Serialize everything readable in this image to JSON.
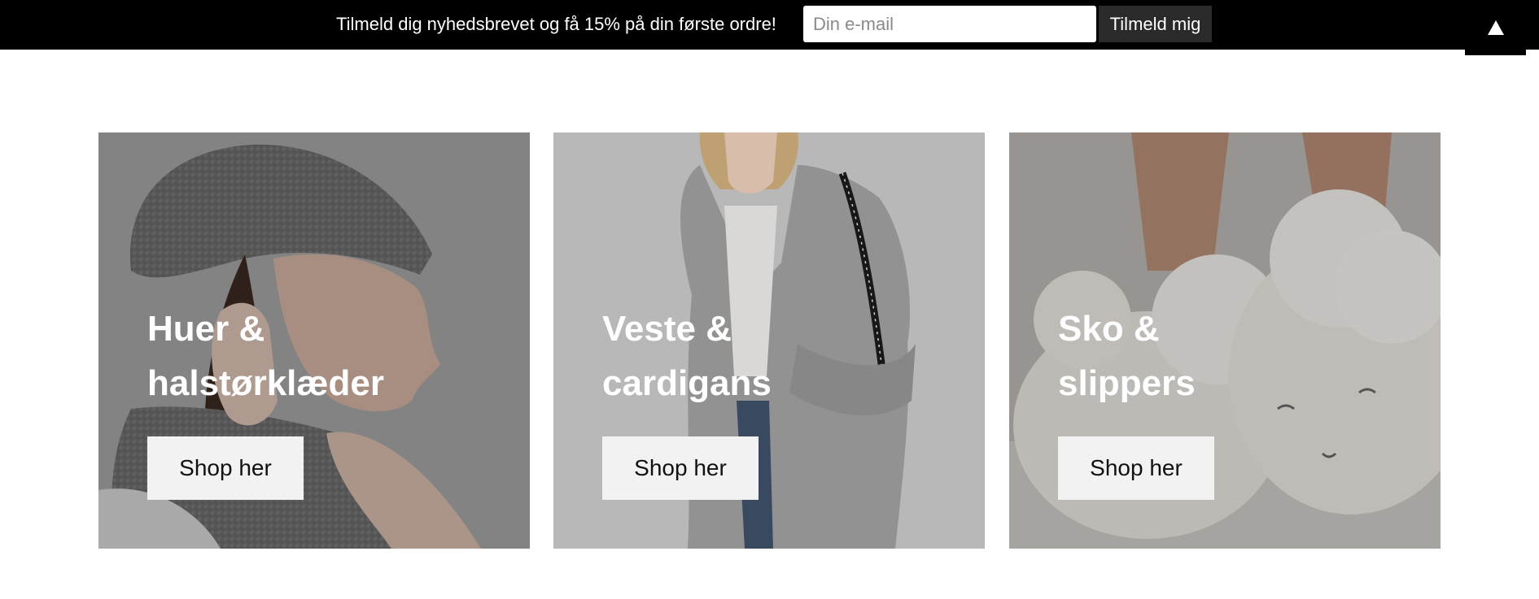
{
  "newsletter": {
    "text": "Tilmeld dig nyhedsbrevet og få 15% på din første ordre!",
    "email_placeholder": "Din e-mail",
    "email_value": "",
    "subscribe_label": "Tilmeld mig",
    "scroll_top_icon": "triangle-up-icon"
  },
  "categories": [
    {
      "title_line1": "Huer &",
      "title_line2": "halstørklæder",
      "button_label": "Shop her"
    },
    {
      "title_line1": "Veste &",
      "title_line2": "cardigans",
      "button_label": "Shop her"
    },
    {
      "title_line1": "Sko &",
      "title_line2": "slippers",
      "button_label": "Shop her"
    }
  ],
  "colors": {
    "bar_background": "#000000",
    "button_dark": "#2a2a2a",
    "card_button": "#f2f2f2",
    "card_title": "#ffffff"
  }
}
